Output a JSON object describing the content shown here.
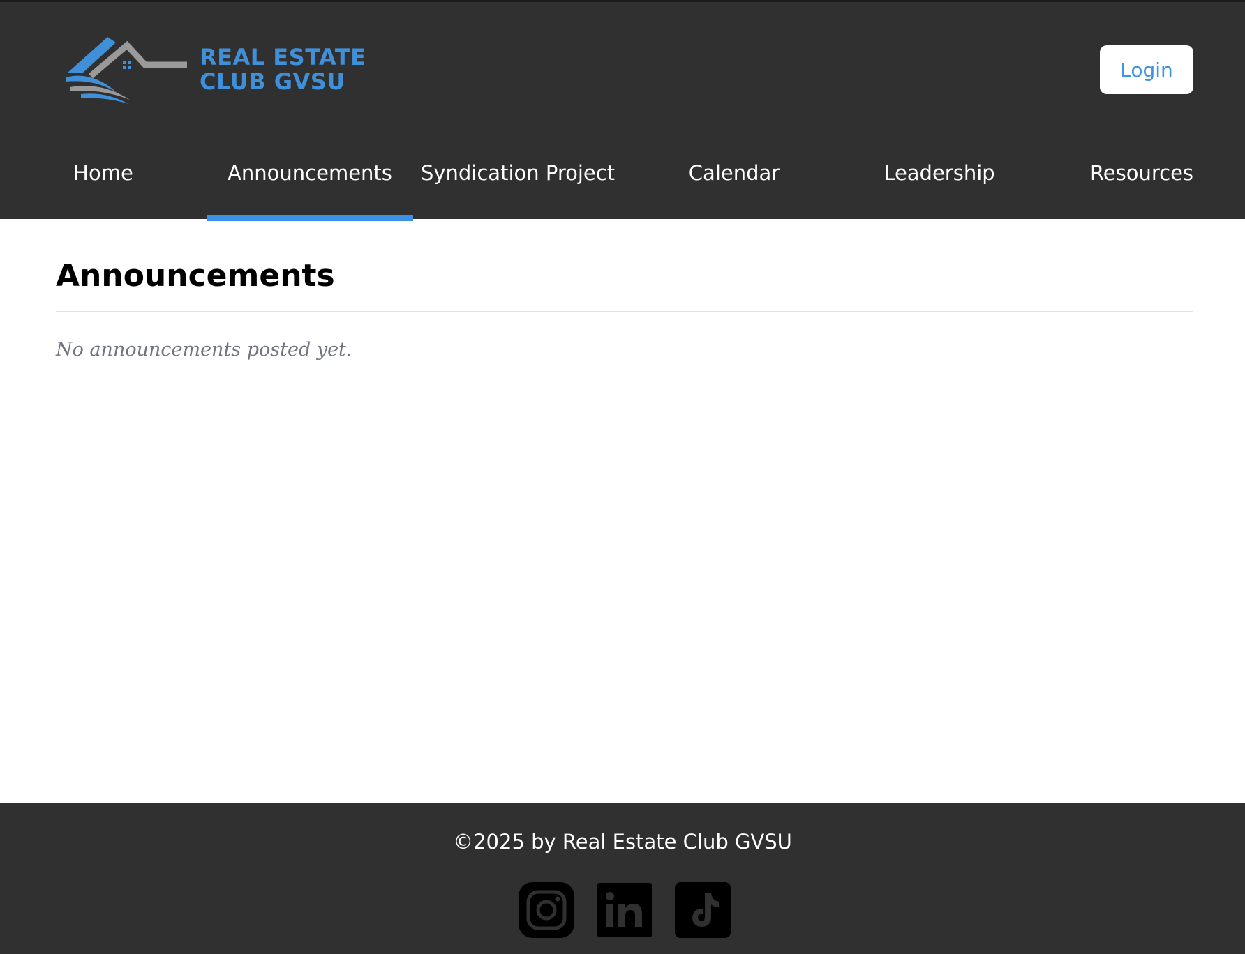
{
  "header": {
    "logo": {
      "line1": "REAL ESTATE",
      "line2": "CLUB GVSU",
      "brand_color": "#3f8fd9",
      "icon": "house-roof-logo-icon"
    },
    "login_label": "Login",
    "background": "#303030"
  },
  "nav": {
    "items": [
      {
        "label": "Home",
        "active": false
      },
      {
        "label": "Announcements",
        "active": true
      },
      {
        "label": "Syndication Project",
        "active": false
      },
      {
        "label": "Calendar",
        "active": false
      },
      {
        "label": "Leadership",
        "active": false
      },
      {
        "label": "Resources",
        "active": false
      }
    ],
    "active_indicator_color": "#3a93e6"
  },
  "main": {
    "title": "Announcements",
    "empty_message": "No announcements posted yet."
  },
  "footer": {
    "copyright": "©2025 by Real Estate Club GVSU",
    "social": [
      {
        "name": "instagram",
        "icon": "instagram-icon"
      },
      {
        "name": "linkedin",
        "icon": "linkedin-icon"
      },
      {
        "name": "tiktok",
        "icon": "tiktok-icon"
      }
    ]
  }
}
